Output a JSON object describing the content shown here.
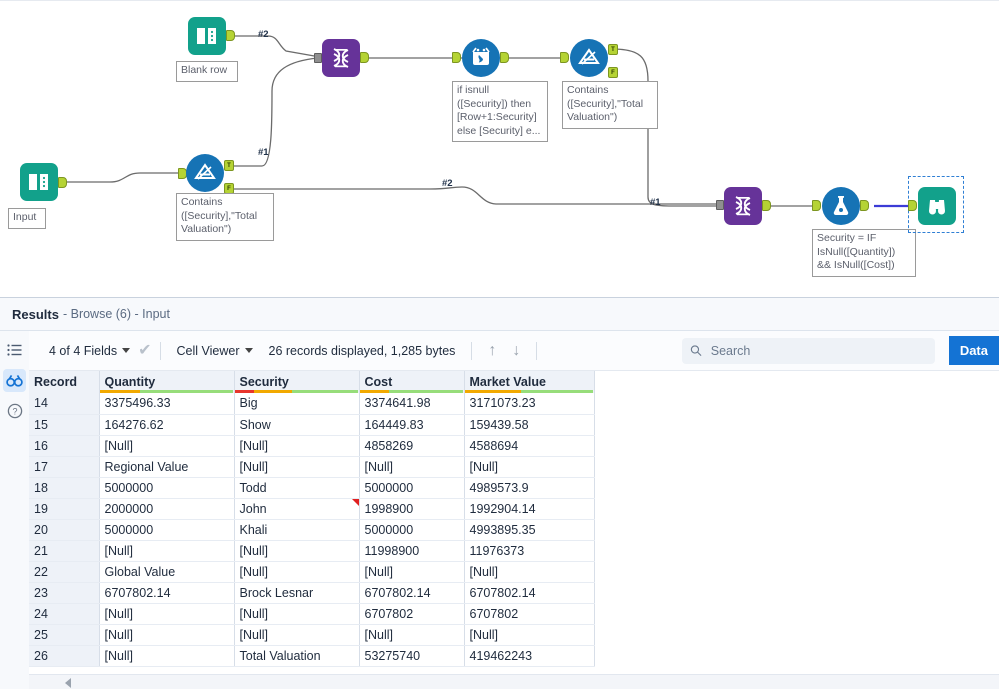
{
  "canvas": {
    "nodes": [
      {
        "id": "blank-row",
        "label": "Blank row",
        "icon": "input-data-icon",
        "type": "teal"
      },
      {
        "id": "input",
        "label": "Input",
        "icon": "input-data-icon",
        "type": "teal"
      },
      {
        "id": "filter-1",
        "label": "Contains\n([Security],\"Total\nValuation\")",
        "icon": "filter-icon",
        "type": "circle"
      },
      {
        "id": "union-1",
        "label": "",
        "icon": "union-icon",
        "type": "purple"
      },
      {
        "id": "multirow-formula",
        "label": "if isnull\n([Security]) then\n[Row+1:Security]\nelse [Security] e...",
        "icon": "multi-row-formula-icon",
        "type": "circle"
      },
      {
        "id": "filter-2",
        "label": "Contains\n([Security],\"Total\nValuation\")",
        "icon": "filter-icon",
        "type": "circle"
      },
      {
        "id": "union-2",
        "label": "",
        "icon": "union-icon",
        "type": "purple"
      },
      {
        "id": "formula",
        "label": "Security = IF\nIsNull([Quantity])\n&& IsNull([Cost])",
        "icon": "formula-icon",
        "type": "circle"
      },
      {
        "id": "browse",
        "label": "",
        "icon": "browse-binoculars-icon",
        "type": "teal"
      }
    ],
    "connection_labels": [
      "#2",
      "#1",
      "#2",
      "#1"
    ],
    "port_tags": [
      "T",
      "F",
      "T",
      "F"
    ]
  },
  "results": {
    "title": "Results",
    "subtitle": "- Browse (6) - Input",
    "rail": [
      {
        "name": "list-view-icon",
        "active": false
      },
      {
        "name": "browse-binoculars-icon",
        "active": true
      },
      {
        "name": "help-icon",
        "active": false
      }
    ],
    "toolbar": {
      "fields_label": "4 of 4 Fields",
      "viewer_label": "Cell Viewer",
      "record_info": "26 records displayed, 1,285 bytes",
      "up_arrow": "↑",
      "down_arrow": "↓",
      "check_glyph": "✔"
    },
    "search": {
      "placeholder": "Search",
      "value": ""
    },
    "data_button": "Data",
    "accent_color": "#1473d4"
  },
  "table": {
    "columns": [
      {
        "label": "Record",
        "underline": []
      },
      {
        "label": "Quantity",
        "underline": [
          {
            "color": "#f2a900",
            "pct": 30
          },
          {
            "color": "#97dd7a",
            "pct": 70
          }
        ]
      },
      {
        "label": "Security",
        "underline": [
          {
            "color": "#e8352c",
            "pct": 16
          },
          {
            "color": "#f2a900",
            "pct": 30
          },
          {
            "color": "#97dd7a",
            "pct": 54
          }
        ]
      },
      {
        "label": "Cost",
        "underline": [
          {
            "color": "#f2a900",
            "pct": 28
          },
          {
            "color": "#97dd7a",
            "pct": 72
          }
        ]
      },
      {
        "label": "Market Value",
        "underline": [
          {
            "color": "#f2a900",
            "pct": 44
          },
          {
            "color": "#97dd7a",
            "pct": 56
          }
        ]
      }
    ],
    "null_text": "[Null]",
    "rows": [
      {
        "record": "14",
        "quantity": "3375496.33",
        "security": "Big",
        "cost": "3374641.98",
        "market_value": "3171073.23",
        "flag": false
      },
      {
        "record": "15",
        "quantity": "164276.62",
        "security": "Show",
        "cost": "164449.83",
        "market_value": "159439.58",
        "flag": false
      },
      {
        "record": "16",
        "quantity": "[Null]",
        "security": "[Null]",
        "cost": "4858269",
        "market_value": "4588694",
        "flag": false
      },
      {
        "record": "17",
        "quantity": "Regional Value",
        "security": "[Null]",
        "cost": "[Null]",
        "market_value": "[Null]",
        "flag": false
      },
      {
        "record": "18",
        "quantity": "5000000",
        "security": "Todd",
        "cost": "5000000",
        "market_value": "4989573.9",
        "flag": false
      },
      {
        "record": "19",
        "quantity": "2000000",
        "security": "John",
        "cost": "1998900",
        "market_value": "1992904.14",
        "flag": true
      },
      {
        "record": "20",
        "quantity": "5000000",
        "security": "Khali",
        "cost": "5000000",
        "market_value": "4993895.35",
        "flag": false
      },
      {
        "record": "21",
        "quantity": "[Null]",
        "security": "[Null]",
        "cost": "11998900",
        "market_value": "11976373",
        "flag": false
      },
      {
        "record": "22",
        "quantity": "Global Value",
        "security": "[Null]",
        "cost": "[Null]",
        "market_value": "[Null]",
        "flag": false
      },
      {
        "record": "23",
        "quantity": "6707802.14",
        "security": "Brock Lesnar",
        "cost": "6707802.14",
        "market_value": "6707802.14",
        "flag": false
      },
      {
        "record": "24",
        "quantity": "[Null]",
        "security": "[Null]",
        "cost": "6707802",
        "market_value": "6707802",
        "flag": false
      },
      {
        "record": "25",
        "quantity": "[Null]",
        "security": "[Null]",
        "cost": "[Null]",
        "market_value": "[Null]",
        "flag": false
      },
      {
        "record": "26",
        "quantity": "[Null]",
        "security": "Total Valuation",
        "cost": "53275740",
        "market_value": "419462243",
        "flag": false
      }
    ]
  }
}
